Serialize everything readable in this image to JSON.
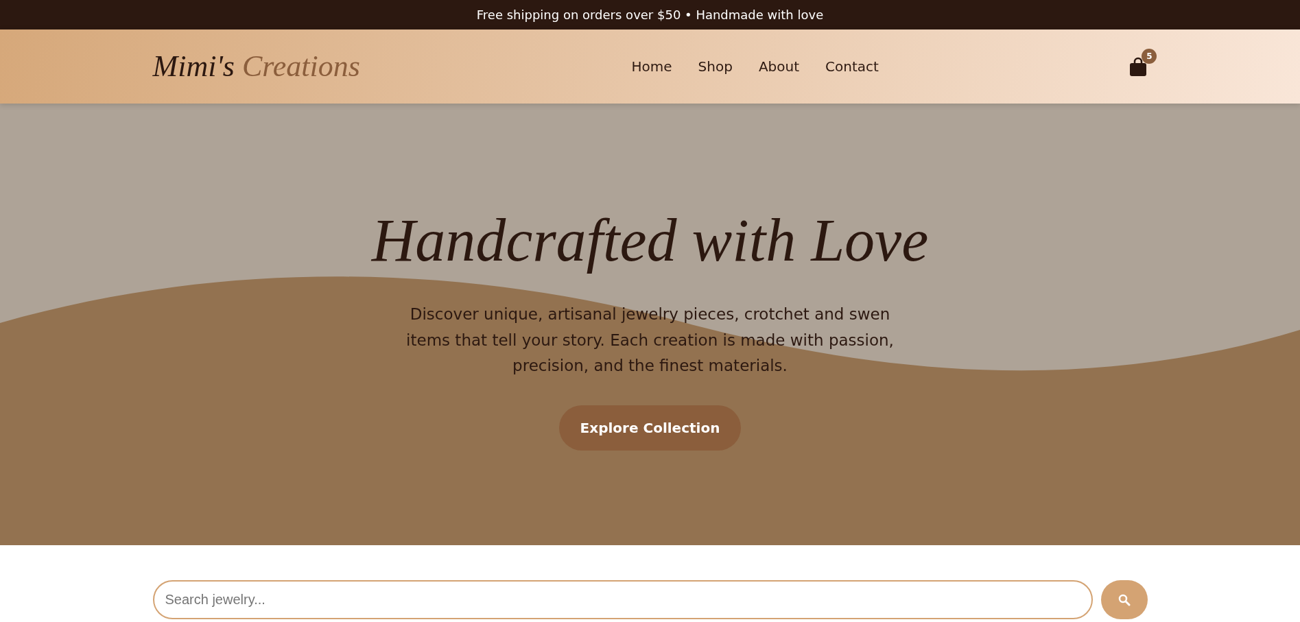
{
  "announcement": "Free shipping on orders over $50 • Handmade with love",
  "logo": {
    "first": "Mimi's",
    "second": "Creations"
  },
  "nav": [
    {
      "label": "Home"
    },
    {
      "label": "Shop"
    },
    {
      "label": "About"
    },
    {
      "label": "Contact"
    }
  ],
  "cart": {
    "count": "5"
  },
  "hero": {
    "title": "Handcrafted with Love",
    "text": "Discover unique, artisanal jewelry pieces, crotchet and swen items that tell your story. Each creation is made with passion, precision, and the finest materials.",
    "button": "Explore Collection"
  },
  "search": {
    "placeholder": "Search jewelry..."
  }
}
